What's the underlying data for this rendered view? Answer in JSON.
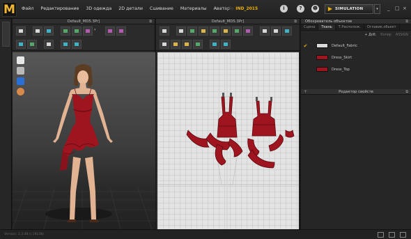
{
  "app": {
    "logo_letter": "M"
  },
  "menu": [
    "Файл",
    "Редактирование",
    "3D одежда",
    "2D детали",
    "Сшивание",
    "Материалы",
    "Аватар"
  ],
  "user": {
    "prefix": "Hello",
    "name": "IND_2015"
  },
  "simulation": {
    "label": "SIMULATION"
  },
  "window_controls": {
    "minimize": "_",
    "maximize": "□",
    "close": "×"
  },
  "panel_3d": {
    "title": "Default_MD5.3Pr]"
  },
  "panel_2d": {
    "title": "Default_MD5.3Pr]"
  },
  "object_browser": {
    "title": "Обозреватель объектов",
    "tabs": [
      "Сцена",
      "Ткань",
      "Т.Располож.",
      "Оглавик.обьект"
    ],
    "active_tab": 1,
    "tools": {
      "add": "+ Доб.",
      "copy": "Копир",
      "assign": "ASSIGN"
    },
    "fabrics": [
      {
        "name": "Default_Fabric",
        "color": "#d9d9d9",
        "checked": true
      },
      {
        "name": "Dress_Skirt",
        "color": "#9e1520",
        "checked": false
      },
      {
        "name": "Dress_Top",
        "color": "#9e1520",
        "checked": false
      }
    ]
  },
  "property_editor": {
    "title": "Редактор свойств"
  },
  "status": {
    "version": "Version: 2.3.48   (r.19138)"
  },
  "colors": {
    "accent": "#f0b000",
    "garment": "#9e1520",
    "garment_dark": "#6e0d15"
  }
}
